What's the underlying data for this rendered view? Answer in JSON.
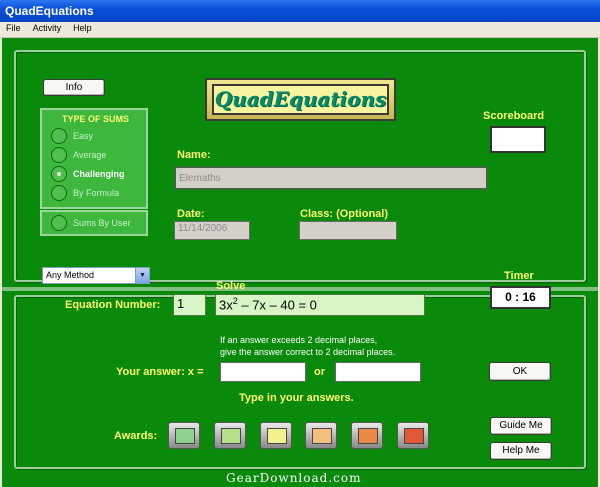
{
  "window": {
    "title": "QuadEquations"
  },
  "menu": [
    "File",
    "Activity",
    "Help"
  ],
  "top": {
    "info_label": "Info",
    "logo_text": "QuadEquations",
    "type_title": "TYPE OF SUMS",
    "types": [
      "Easy",
      "Average",
      "Challenging",
      "By Formula"
    ],
    "selected_type": "Challenging",
    "sums_by_user": "Sums By User",
    "scoreboard_label": "Scoreboard",
    "scoreboard_value": "",
    "name_label": "Name:",
    "name_value": "Elemaths",
    "date_label": "Date:",
    "date_value": "11/14/2006",
    "class_label": "Class: (Optional)",
    "class_value": ""
  },
  "bottom": {
    "method_select": "Any Method",
    "solve_label": "Solve",
    "equation_number_label": "Equation Number:",
    "equation_number": "1",
    "equation_text": "3x",
    "equation_exp": "2",
    "equation_rest": " – 7x – 40 = 0",
    "timer_label": "Timer",
    "timer_value": "0 : 16",
    "note_line1": "If an answer exceeds 2 decimal places,",
    "note_line2": "give the answer correct to 2 decimal places.",
    "answer_label": "Your answer:  x =",
    "answer1": "",
    "or_label": "or",
    "answer2": "",
    "ok_label": "OK",
    "instruction": "Type in your answers.",
    "awards_label": "Awards:",
    "award_colors": [
      "#8fd28f",
      "#b7e08c",
      "#f2f28c",
      "#f2c07a",
      "#ea8a42",
      "#e05a3a"
    ],
    "guide_label": "Guide Me",
    "help_label": "Help Me"
  },
  "watermark": "GearDownload.com"
}
